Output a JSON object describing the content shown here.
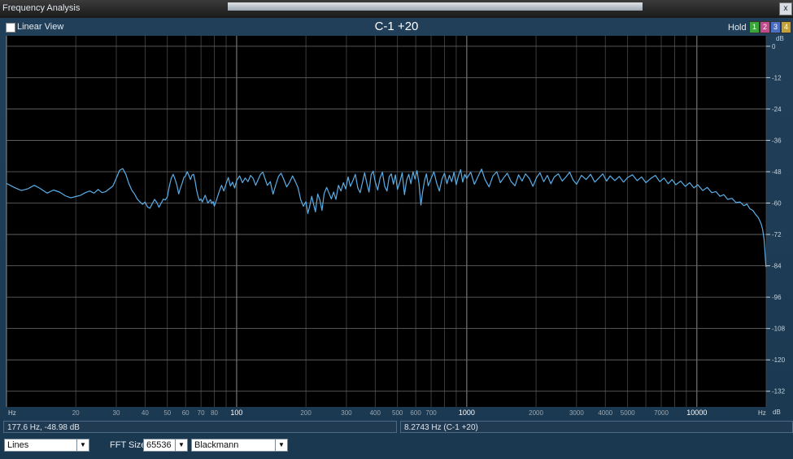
{
  "window": {
    "title": "Frequency Analysis",
    "close_glyph": "x"
  },
  "toolbar": {
    "linear_view_label": "Linear View",
    "plot_title": "C-1 +20",
    "hold_label": "Hold",
    "hold_buttons": [
      "1",
      "2",
      "3",
      "4"
    ],
    "hold_colors": [
      "#3aa63a",
      "#c24a8c",
      "#4a6ec2",
      "#c2a13a"
    ]
  },
  "axes": {
    "db_unit_top": "dB",
    "db_unit_bottom": "dB",
    "db_ticks": [
      "0",
      "-12",
      "-24",
      "-36",
      "-48",
      "-60",
      "-72",
      "-84",
      "-96",
      "-108",
      "-120",
      "-132"
    ],
    "hz_unit_left": "Hz",
    "hz_unit_right": "Hz",
    "hz_ticks": [
      "20",
      "30",
      "40",
      "50",
      "60",
      "70",
      "80",
      "100",
      "200",
      "300",
      "400",
      "500",
      "600",
      "700",
      "1000",
      "2000",
      "3000",
      "4000",
      "5000",
      "7000",
      "10000"
    ],
    "hz_bold_ticks": [
      "100",
      "1000",
      "10000"
    ]
  },
  "chart_data": {
    "type": "line",
    "xscale": "log",
    "xlim": [
      10,
      20000
    ],
    "ylim": [
      -138,
      4
    ],
    "series_color": "#5aaee8",
    "grid": true,
    "points": [
      [
        10,
        -52.5
      ],
      [
        10.8,
        -54.0
      ],
      [
        11.6,
        -55.2
      ],
      [
        12.4,
        -54.5
      ],
      [
        13.2,
        -53.2
      ],
      [
        14.0,
        -54.4
      ],
      [
        15.0,
        -56.2
      ],
      [
        16.0,
        -55.0
      ],
      [
        17.0,
        -55.8
      ],
      [
        18.0,
        -57.2
      ],
      [
        19.0,
        -58.0
      ],
      [
        20.0,
        -57.5
      ],
      [
        21.0,
        -57.0
      ],
      [
        22.0,
        -56.0
      ],
      [
        23.0,
        -55.4
      ],
      [
        24.0,
        -56.2
      ],
      [
        25.0,
        -54.8
      ],
      [
        26.0,
        -56.0
      ],
      [
        27.0,
        -55.6
      ],
      [
        28.0,
        -54.5
      ],
      [
        29.0,
        -53.5
      ],
      [
        30.0,
        -50.5
      ],
      [
        31.0,
        -47.5
      ],
      [
        32.0,
        -46.8
      ],
      [
        33.0,
        -49.0
      ],
      [
        34.0,
        -52.5
      ],
      [
        35.0,
        -55.0
      ],
      [
        36.0,
        -56.5
      ],
      [
        37.0,
        -58.5
      ],
      [
        38.0,
        -59.5
      ],
      [
        39.0,
        -60.5
      ],
      [
        40.0,
        -59.6
      ],
      [
        41.0,
        -61.5
      ],
      [
        42.0,
        -62.0
      ],
      [
        43.0,
        -60.2
      ],
      [
        44.0,
        -58.6
      ],
      [
        45.0,
        -59.8
      ],
      [
        46.0,
        -61.6
      ],
      [
        47.0,
        -60.0
      ],
      [
        48.0,
        -58.5
      ],
      [
        49.0,
        -58.8
      ],
      [
        50.0,
        -57.6
      ],
      [
        51.0,
        -53.5
      ],
      [
        52.0,
        -50.5
      ],
      [
        53.0,
        -49.0
      ],
      [
        54.0,
        -50.8
      ],
      [
        55.0,
        -53.2
      ],
      [
        56.0,
        -56.5
      ],
      [
        57.0,
        -54.2
      ],
      [
        58.0,
        -52.4
      ],
      [
        59.0,
        -50.2
      ],
      [
        60.0,
        -49.6
      ],
      [
        61.0,
        -48.0
      ],
      [
        62.0,
        -49.4
      ],
      [
        63.0,
        -51.0
      ],
      [
        64.0,
        -49.3
      ],
      [
        65.0,
        -49.0
      ],
      [
        66.0,
        -51.6
      ],
      [
        67.0,
        -55.0
      ],
      [
        68.0,
        -57.5
      ],
      [
        69.0,
        -59.0
      ],
      [
        70.0,
        -58.4
      ],
      [
        71.0,
        -59.6
      ],
      [
        72.0,
        -58.2
      ],
      [
        73.0,
        -57.0
      ],
      [
        74.0,
        -58.5
      ],
      [
        75.0,
        -60.0
      ],
      [
        76.0,
        -59.3
      ],
      [
        77.0,
        -58.7
      ],
      [
        78.0,
        -60.2
      ],
      [
        79.0,
        -59.4
      ],
      [
        80.0,
        -61.2
      ],
      [
        82.0,
        -58.4
      ],
      [
        84.0,
        -55.6
      ],
      [
        86.0,
        -53.2
      ],
      [
        88.0,
        -55.4
      ],
      [
        90.0,
        -52.6
      ],
      [
        92.0,
        -50.2
      ],
      [
        94.0,
        -53.5
      ],
      [
        96.0,
        -52.0
      ],
      [
        98.0,
        -54.2
      ],
      [
        100.0,
        -51.5
      ],
      [
        103.0,
        -49.6
      ],
      [
        106.0,
        -52.2
      ],
      [
        109.0,
        -50.4
      ],
      [
        112.0,
        -51.8
      ],
      [
        115.0,
        -49.4
      ],
      [
        118.0,
        -50.6
      ],
      [
        121.0,
        -53.2
      ],
      [
        124.0,
        -51.0
      ],
      [
        127.0,
        -49.0
      ],
      [
        130.0,
        -48.2
      ],
      [
        133.0,
        -50.8
      ],
      [
        136.0,
        -53.2
      ],
      [
        140.0,
        -51.8
      ],
      [
        144.0,
        -56.6
      ],
      [
        148.0,
        -53.0
      ],
      [
        152.0,
        -49.8
      ],
      [
        156.0,
        -48.6
      ],
      [
        160.0,
        -50.8
      ],
      [
        165.0,
        -53.8
      ],
      [
        170.0,
        -52.0
      ],
      [
        175.0,
        -49.6
      ],
      [
        180.0,
        -51.8
      ],
      [
        185.0,
        -54.2
      ],
      [
        190.0,
        -58.8
      ],
      [
        195.0,
        -61.2
      ],
      [
        200.0,
        -59.5
      ],
      [
        204.0,
        -64.0
      ],
      [
        208.0,
        -61.0
      ],
      [
        212.0,
        -57.4
      ],
      [
        216.0,
        -60.5
      ],
      [
        220.0,
        -63.4
      ],
      [
        225.0,
        -56.5
      ],
      [
        230.0,
        -58.8
      ],
      [
        235.0,
        -62.8
      ],
      [
        240.0,
        -56.4
      ],
      [
        246.0,
        -54.0
      ],
      [
        252.0,
        -56.2
      ],
      [
        258.0,
        -58.4
      ],
      [
        264.0,
        -55.8
      ],
      [
        270.0,
        -58.6
      ],
      [
        277.0,
        -53.2
      ],
      [
        284.0,
        -55.4
      ],
      [
        291.0,
        -52.2
      ],
      [
        298.0,
        -54.6
      ],
      [
        305.0,
        -50.0
      ],
      [
        312.0,
        -53.6
      ],
      [
        320.0,
        -51.4
      ],
      [
        328.0,
        -49.0
      ],
      [
        336.0,
        -54.2
      ],
      [
        344.0,
        -56.0
      ],
      [
        352.0,
        -52.2
      ],
      [
        360.0,
        -48.4
      ],
      [
        368.0,
        -52.4
      ],
      [
        376.0,
        -55.8
      ],
      [
        384.0,
        -49.2
      ],
      [
        392.0,
        -47.8
      ],
      [
        400.0,
        -51.8
      ],
      [
        410.0,
        -55.0
      ],
      [
        420.0,
        -50.4
      ],
      [
        430.0,
        -48.2
      ],
      [
        440.0,
        -53.6
      ],
      [
        450.0,
        -55.4
      ],
      [
        460.0,
        -50.0
      ],
      [
        470.0,
        -48.8
      ],
      [
        480.0,
        -52.8
      ],
      [
        490.0,
        -49.2
      ],
      [
        500.0,
        -54.8
      ],
      [
        512.0,
        -52.0
      ],
      [
        524.0,
        -48.4
      ],
      [
        536.0,
        -56.8
      ],
      [
        548.0,
        -51.2
      ],
      [
        560.0,
        -49.0
      ],
      [
        572.0,
        -52.6
      ],
      [
        584.0,
        -48.0
      ],
      [
        596.0,
        -50.8
      ],
      [
        608.0,
        -47.6
      ],
      [
        620.0,
        -52.4
      ],
      [
        632.0,
        -60.8
      ],
      [
        644.0,
        -55.4
      ],
      [
        656.0,
        -51.2
      ],
      [
        668.0,
        -48.8
      ],
      [
        680.0,
        -53.4
      ],
      [
        700.0,
        -50.6
      ],
      [
        720.0,
        -48.0
      ],
      [
        740.0,
        -52.4
      ],
      [
        760.0,
        -55.4
      ],
      [
        780.0,
        -50.8
      ],
      [
        800.0,
        -48.6
      ],
      [
        820.0,
        -52.6
      ],
      [
        840.0,
        -49.4
      ],
      [
        860.0,
        -51.8
      ],
      [
        880.0,
        -48.2
      ],
      [
        900.0,
        -53.0
      ],
      [
        920.0,
        -49.6
      ],
      [
        940.0,
        -47.2
      ],
      [
        960.0,
        -52.0
      ],
      [
        980.0,
        -49.0
      ],
      [
        1000.0,
        -50.6
      ],
      [
        1040.0,
        -48.2
      ],
      [
        1080.0,
        -52.8
      ],
      [
        1120.0,
        -49.8
      ],
      [
        1160.0,
        -47.0
      ],
      [
        1200.0,
        -51.0
      ],
      [
        1250.0,
        -53.8
      ],
      [
        1300.0,
        -49.6
      ],
      [
        1350.0,
        -48.0
      ],
      [
        1400.0,
        -52.2
      ],
      [
        1450.0,
        -50.2
      ],
      [
        1500.0,
        -48.6
      ],
      [
        1560.0,
        -51.8
      ],
      [
        1620.0,
        -53.4
      ],
      [
        1680.0,
        -49.2
      ],
      [
        1740.0,
        -51.6
      ],
      [
        1800.0,
        -48.8
      ],
      [
        1870.0,
        -50.6
      ],
      [
        1940.0,
        -53.6
      ],
      [
        2010.0,
        -50.2
      ],
      [
        2080.0,
        -48.4
      ],
      [
        2160.0,
        -51.8
      ],
      [
        2240.0,
        -49.4
      ],
      [
        2320.0,
        -52.6
      ],
      [
        2400.0,
        -50.0
      ],
      [
        2500.0,
        -48.8
      ],
      [
        2600.0,
        -51.6
      ],
      [
        2700.0,
        -50.0
      ],
      [
        2800.0,
        -48.2
      ],
      [
        2900.0,
        -51.2
      ],
      [
        3000.0,
        -52.8
      ],
      [
        3150.0,
        -49.4
      ],
      [
        3300.0,
        -51.0
      ],
      [
        3450.0,
        -49.0
      ],
      [
        3600.0,
        -52.0
      ],
      [
        3750.0,
        -50.4
      ],
      [
        3900.0,
        -48.8
      ],
      [
        4050.0,
        -51.6
      ],
      [
        4200.0,
        -49.6
      ],
      [
        4400.0,
        -51.4
      ],
      [
        4600.0,
        -49.8
      ],
      [
        4800.0,
        -52.0
      ],
      [
        5000.0,
        -50.2
      ],
      [
        5250.0,
        -49.2
      ],
      [
        5500.0,
        -51.4
      ],
      [
        5750.0,
        -50.0
      ],
      [
        6000.0,
        -52.2
      ],
      [
        6300.0,
        -50.6
      ],
      [
        6600.0,
        -49.4
      ],
      [
        6900.0,
        -51.8
      ],
      [
        7200.0,
        -50.4
      ],
      [
        7500.0,
        -52.6
      ],
      [
        7800.0,
        -51.0
      ],
      [
        8100.0,
        -53.0
      ],
      [
        8500.0,
        -51.6
      ],
      [
        8900.0,
        -53.6
      ],
      [
        9300.0,
        -52.2
      ],
      [
        9700.0,
        -54.2
      ],
      [
        10100.0,
        -53.0
      ],
      [
        10600.0,
        -55.2
      ],
      [
        11100.0,
        -54.0
      ],
      [
        11600.0,
        -56.0
      ],
      [
        12100.0,
        -55.6
      ],
      [
        12600.0,
        -57.4
      ],
      [
        13100.0,
        -56.8
      ],
      [
        13600.0,
        -58.6
      ],
      [
        14200.0,
        -58.2
      ],
      [
        14800.0,
        -59.8
      ],
      [
        15400.0,
        -59.6
      ],
      [
        16000.0,
        -61.0
      ],
      [
        16500.0,
        -60.4
      ],
      [
        17000.0,
        -62.2
      ],
      [
        17500.0,
        -62.8
      ],
      [
        18000.0,
        -64.4
      ],
      [
        18500.0,
        -65.6
      ],
      [
        19000.0,
        -67.8
      ],
      [
        19300.0,
        -70.0
      ],
      [
        19600.0,
        -74.0
      ],
      [
        19800.0,
        -80.0
      ],
      [
        19950.0,
        -84.5
      ]
    ]
  },
  "status": {
    "cursor_readout": "177.6 Hz, -48.98 dB",
    "note_readout": "8.2743 Hz (C-1 +20)"
  },
  "controls": {
    "display_mode": "Lines",
    "fft_size_label": "FFT Size",
    "fft_size": "65536",
    "window_function": "Blackmann"
  }
}
